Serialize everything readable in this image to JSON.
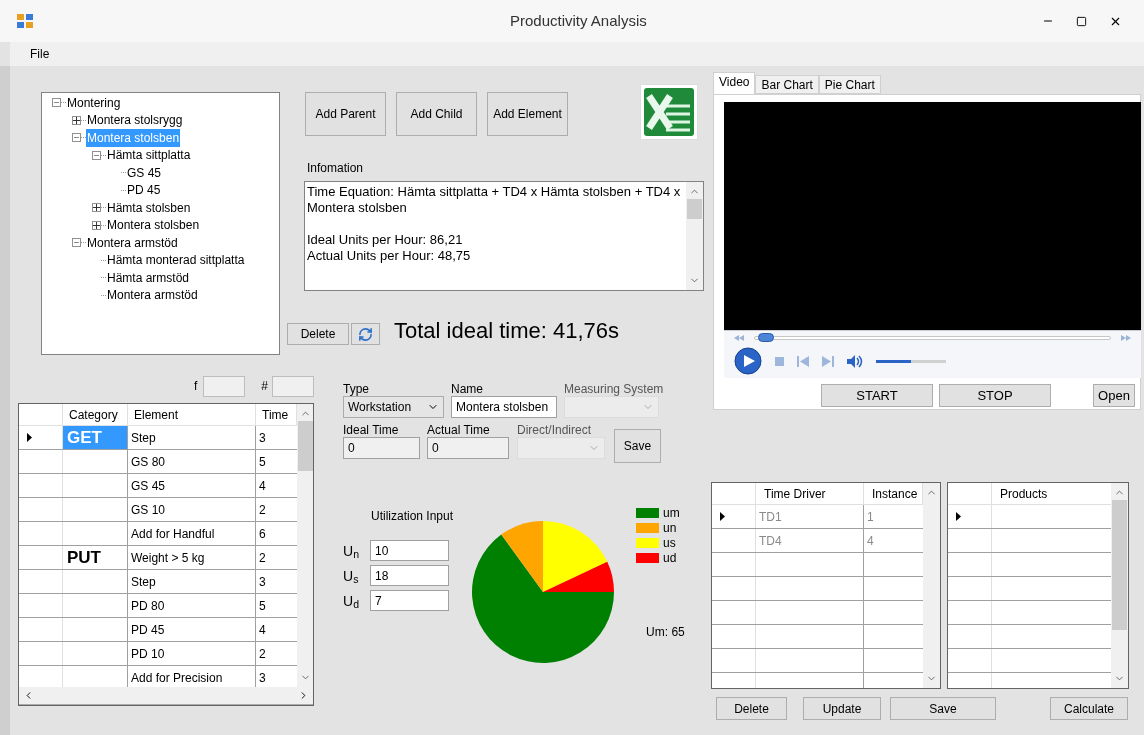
{
  "window": {
    "title": "Productivity Analysis"
  },
  "menu": [
    "File"
  ],
  "tree": [
    {
      "label": "Montering",
      "expanded": true,
      "selected": false,
      "children": [
        {
          "label": "Montera stolsrygg",
          "expanded": false,
          "selected": false
        },
        {
          "label": "Montera stolsben",
          "expanded": true,
          "selected": true,
          "children": [
            {
              "label": "Hämta sittplatta",
              "expanded": true,
              "selected": false,
              "children": [
                {
                  "label": "GS 45",
                  "selected": false
                },
                {
                  "label": "PD 45",
                  "selected": false
                }
              ]
            },
            {
              "label": "Hämta stolsben",
              "expanded": false,
              "selected": false
            },
            {
              "label": "Montera stolsben",
              "expanded": false,
              "selected": false
            }
          ]
        },
        {
          "label": "Montera armstöd",
          "expanded": true,
          "selected": false,
          "children": [
            {
              "label": "Hämta monterad sittplatta",
              "selected": false
            },
            {
              "label": "Hämta armstöd",
              "selected": false
            },
            {
              "label": "Montera armstöd",
              "selected": false
            }
          ]
        }
      ]
    }
  ],
  "tree_buttons": [
    "Add Parent",
    "Add Child",
    "Add Element"
  ],
  "information": {
    "label": "Infomation",
    "paragraphs": [
      [
        "Time Equation: Hämta sittplatta + TD4 x Hämta stolsben + TD4 x Montera stolsben"
      ],
      [
        "Ideal Units per Hour: 86,21",
        "Actual Units per Hour: 48,75"
      ]
    ]
  },
  "delete_button": "Delete",
  "total_ideal_time": "Total ideal time: 41,76s",
  "filter": {
    "f_label": "f",
    "hash_label": "#"
  },
  "elements_table": {
    "columns": [
      "Category",
      "Element",
      "Time"
    ],
    "rows": [
      {
        "category": "GET",
        "element": "Step",
        "time": "3",
        "selected": true
      },
      {
        "element": "GS 80",
        "time": "5",
        "selected": false
      },
      {
        "element": "GS 45",
        "time": "4",
        "selected": false
      },
      {
        "element": "GS 10",
        "time": "2",
        "selected": false
      },
      {
        "element": "Add for Handful",
        "time": "6",
        "selected": false
      },
      {
        "category": "PUT",
        "element": "Weight > 5 kg",
        "time": "2",
        "selected": false
      },
      {
        "element": "Step",
        "time": "3",
        "selected": false
      },
      {
        "element": "PD 80",
        "time": "5",
        "selected": false
      },
      {
        "element": "PD 45",
        "time": "4",
        "selected": false
      },
      {
        "element": "PD 10",
        "time": "2",
        "selected": false
      },
      {
        "element": "Add for Precision",
        "time": "3",
        "selected": false
      }
    ]
  },
  "form": {
    "type": {
      "label": "Type",
      "value": "Workstation"
    },
    "name": {
      "label": "Name",
      "value": "Montera stolsben"
    },
    "measuring_system": {
      "label": "Measuring System",
      "disabled": true
    },
    "ideal_time": {
      "label": "Ideal Time",
      "value": "0"
    },
    "actual_time": {
      "label": "Actual Time",
      "value": "0"
    },
    "direct_indirect": {
      "label": "Direct/Indirect",
      "disabled": true
    },
    "save": "Save"
  },
  "utilization": {
    "title": "Utilization Input",
    "inputs": [
      {
        "label": "U$_{n}$",
        "value": "10"
      },
      {
        "label": "U$_{s}$",
        "value": "18"
      },
      {
        "label": "U$_{d}$",
        "value": "7"
      }
    ],
    "legend": [
      {
        "color": "#008000"
      },
      {
        "color": "#ffa500"
      },
      {
        "color": "#ffff00"
      },
      {
        "color": "#ff0000"
      }
    ],
    "chart_data": {
      "type": "pie",
      "categories": [
        "um",
        "un",
        "us",
        "ud"
      ],
      "values": [
        65,
        10,
        18,
        7
      ]
    },
    "reading": "Um: 65"
  },
  "tabs": [
    {
      "label": "Video",
      "selected": true
    },
    {
      "label": "Bar Chart",
      "selected": false
    },
    {
      "label": "Pie Chart",
      "selected": false
    }
  ],
  "player": {
    "seek": {
      "level": 0.02
    },
    "volume": {
      "level": 0.5
    }
  },
  "video_buttons": [
    "START",
    "STOP",
    "Open"
  ],
  "time_driver_table": {
    "columns": [
      "Time Driver",
      "Instance"
    ],
    "rows": [
      {
        "time_driver": "TD1",
        "instance": "1",
        "selected": true
      },
      {
        "time_driver": "TD4",
        "instance": "4",
        "selected": false
      }
    ]
  },
  "products_table": {
    "columns": [
      "Products"
    ]
  },
  "bottom_buttons": [
    "Delete",
    "Update",
    "Save",
    "Calculate"
  ]
}
